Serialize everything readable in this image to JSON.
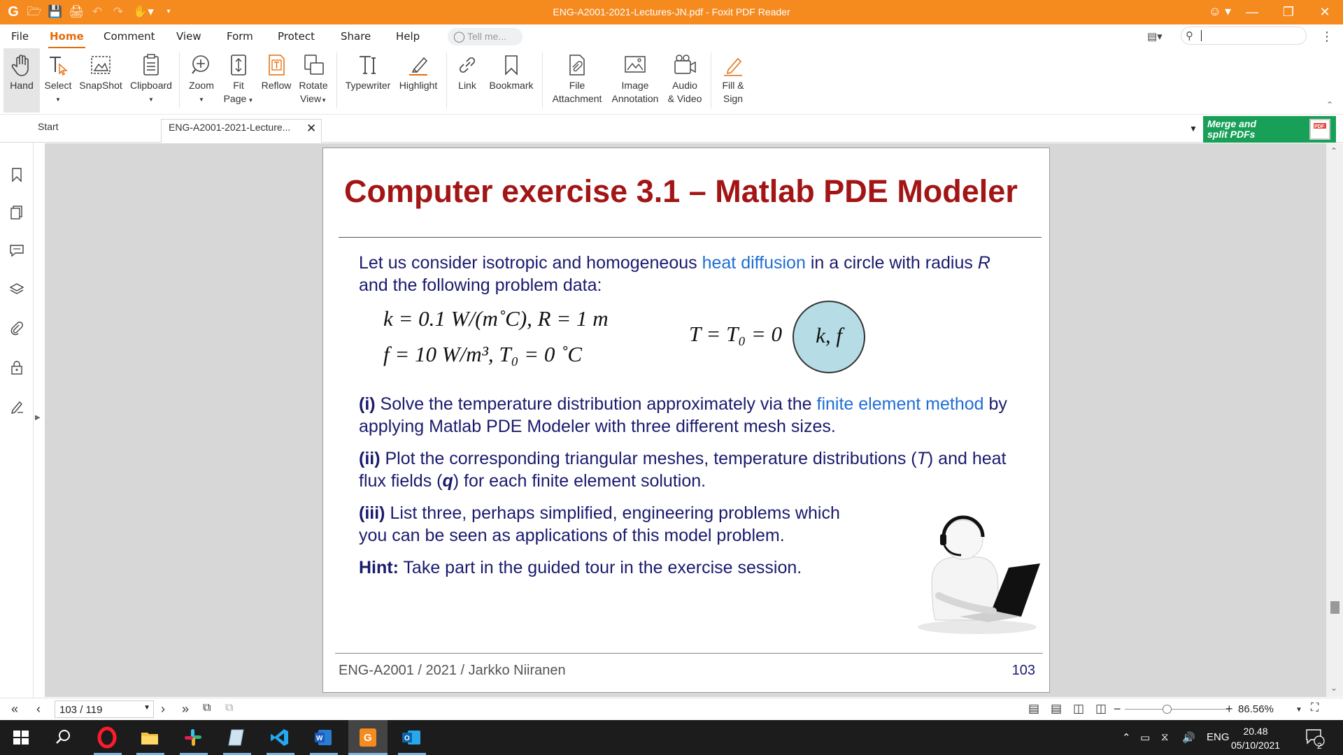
{
  "window": {
    "title": "ENG-A2001-2021-Lectures-JN.pdf - Foxit PDF Reader"
  },
  "menu": {
    "tabs": [
      "File",
      "Home",
      "Comment",
      "View",
      "Form",
      "Protect",
      "Share",
      "Help"
    ],
    "active_tab": "Home",
    "tell_me_placeholder": "Tell me..."
  },
  "ribbon": {
    "items": [
      {
        "label": "Hand",
        "icon": "hand-icon"
      },
      {
        "label": "Select",
        "icon": "select-text-icon"
      },
      {
        "label": "SnapShot",
        "icon": "snapshot-icon"
      },
      {
        "label": "Clipboard",
        "icon": "clipboard-icon"
      },
      {
        "label": "Zoom",
        "icon": "zoom-icon"
      },
      {
        "label": "Fit",
        "label2": "Page",
        "icon": "fit-page-icon"
      },
      {
        "label": "Reflow",
        "icon": "reflow-icon"
      },
      {
        "label": "Rotate",
        "label2": "View",
        "icon": "rotate-view-icon"
      },
      {
        "label": "Typewriter",
        "icon": "typewriter-icon"
      },
      {
        "label": "Highlight",
        "icon": "highlight-icon"
      },
      {
        "label": "Link",
        "icon": "link-icon"
      },
      {
        "label": "Bookmark",
        "icon": "bookmark-icon"
      },
      {
        "label": "File",
        "label2": "Attachment",
        "icon": "file-attachment-icon"
      },
      {
        "label": "Image",
        "label2": "Annotation",
        "icon": "image-annotation-icon"
      },
      {
        "label": "Audio",
        "label2": "& Video",
        "icon": "audio-video-icon"
      },
      {
        "label": "Fill &",
        "label2": "Sign",
        "icon": "fill-sign-icon"
      }
    ]
  },
  "doc_tabs": {
    "start": "Start",
    "current": "ENG-A2001-2021-Lecture..."
  },
  "banner": {
    "line1": "Merge and",
    "line2": "split PDFs",
    "badge": "PDF"
  },
  "slide": {
    "title": "Computer exercise 3.1 – Matlab PDE Modeler",
    "intro_a": "Let us consider isotropic and homogeneous ",
    "intro_link": "heat diffusion",
    "intro_b": " in a circle with radius ",
    "intro_R": "R",
    "intro_c": "and the following problem data:",
    "eq1": "k = 0.1 W/(m˚C), R = 1 m",
    "eq2": "f = 10 W/m³, T₀ = 0 ˚C",
    "bc": "T = T₀ = 0",
    "circle_label": "k, f",
    "i_label": "(i)",
    "i_text_a": "  Solve the temperature distribution approximately via the ",
    "i_link": "finite element method",
    "i_text_b": " by",
    "i_text_c": "applying Matlab PDE Modeler with three different mesh sizes.",
    "ii_label": "(ii)",
    "ii_text_a": "  Plot the corresponding triangular meshes, temperature distributions (",
    "ii_T": "T",
    "ii_text_b": ") and heat",
    "ii_text_c": "flux fields (",
    "ii_q": "q",
    "ii_text_d": ") for each finite element solution.",
    "iii_label": "(iii)",
    "iii_text_a": "  List three, perhaps simplified, engineering problems which",
    "iii_text_b": "you can be seen as applications of this model problem.",
    "hint_label": "Hint:",
    "hint_text": " Take part in the guided tour in the exercise session.",
    "footer_left": "ENG-A2001 / 2021 / Jarkko Niiranen",
    "footer_right": "103"
  },
  "status": {
    "page_value": "103 / 119",
    "zoom": "86.56%"
  },
  "taskbar": {
    "language": "ENG",
    "time": "20.48",
    "date": "05/10/2021",
    "notifications": "2"
  },
  "colors": {
    "titlebar": "#f58a1f",
    "slide_title": "#a31515",
    "slide_text": "#1a1a6e",
    "link": "#1f6ed4",
    "circle_fill": "#b6dde6",
    "banner": "#18a058"
  }
}
